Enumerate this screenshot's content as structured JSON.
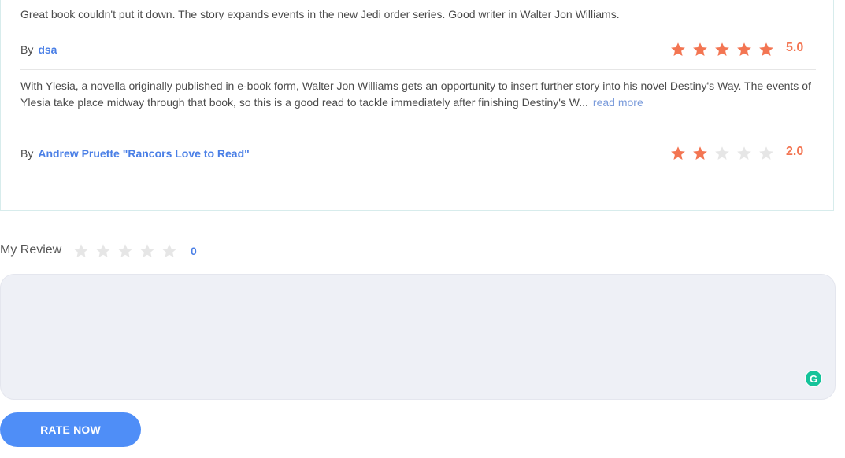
{
  "reviews": [
    {
      "text": "Great book couldn't put it down. The story expands events in the new Jedi order series. Good writer in Walter Jon Williams.",
      "by_label": "By",
      "author": "dsa",
      "rating": 5,
      "rating_label": "5.0"
    },
    {
      "text": "With Ylesia, a novella originally published in e-book form, Walter Jon Williams gets an opportunity to insert further story into his novel Destiny's Way. The events of Ylesia take place midway through that book, so this is a good read to tackle immediately after finishing Destiny's W...",
      "read_more": "read more",
      "by_label": "By",
      "author": "Andrew Pruette \"Rancors Love to Read\"",
      "rating": 2,
      "rating_label": "2.0"
    }
  ],
  "my_review": {
    "label": "My Review",
    "rating": 0,
    "rating_label": "0",
    "textarea_value": "",
    "grammarly_letter": "G"
  },
  "rate_button_label": "RATE NOW",
  "colors": {
    "star_filled": "#f37552",
    "star_empty": "#e6e6e6",
    "accent": "#4f8ef7",
    "grammarly": "#15c39a"
  }
}
